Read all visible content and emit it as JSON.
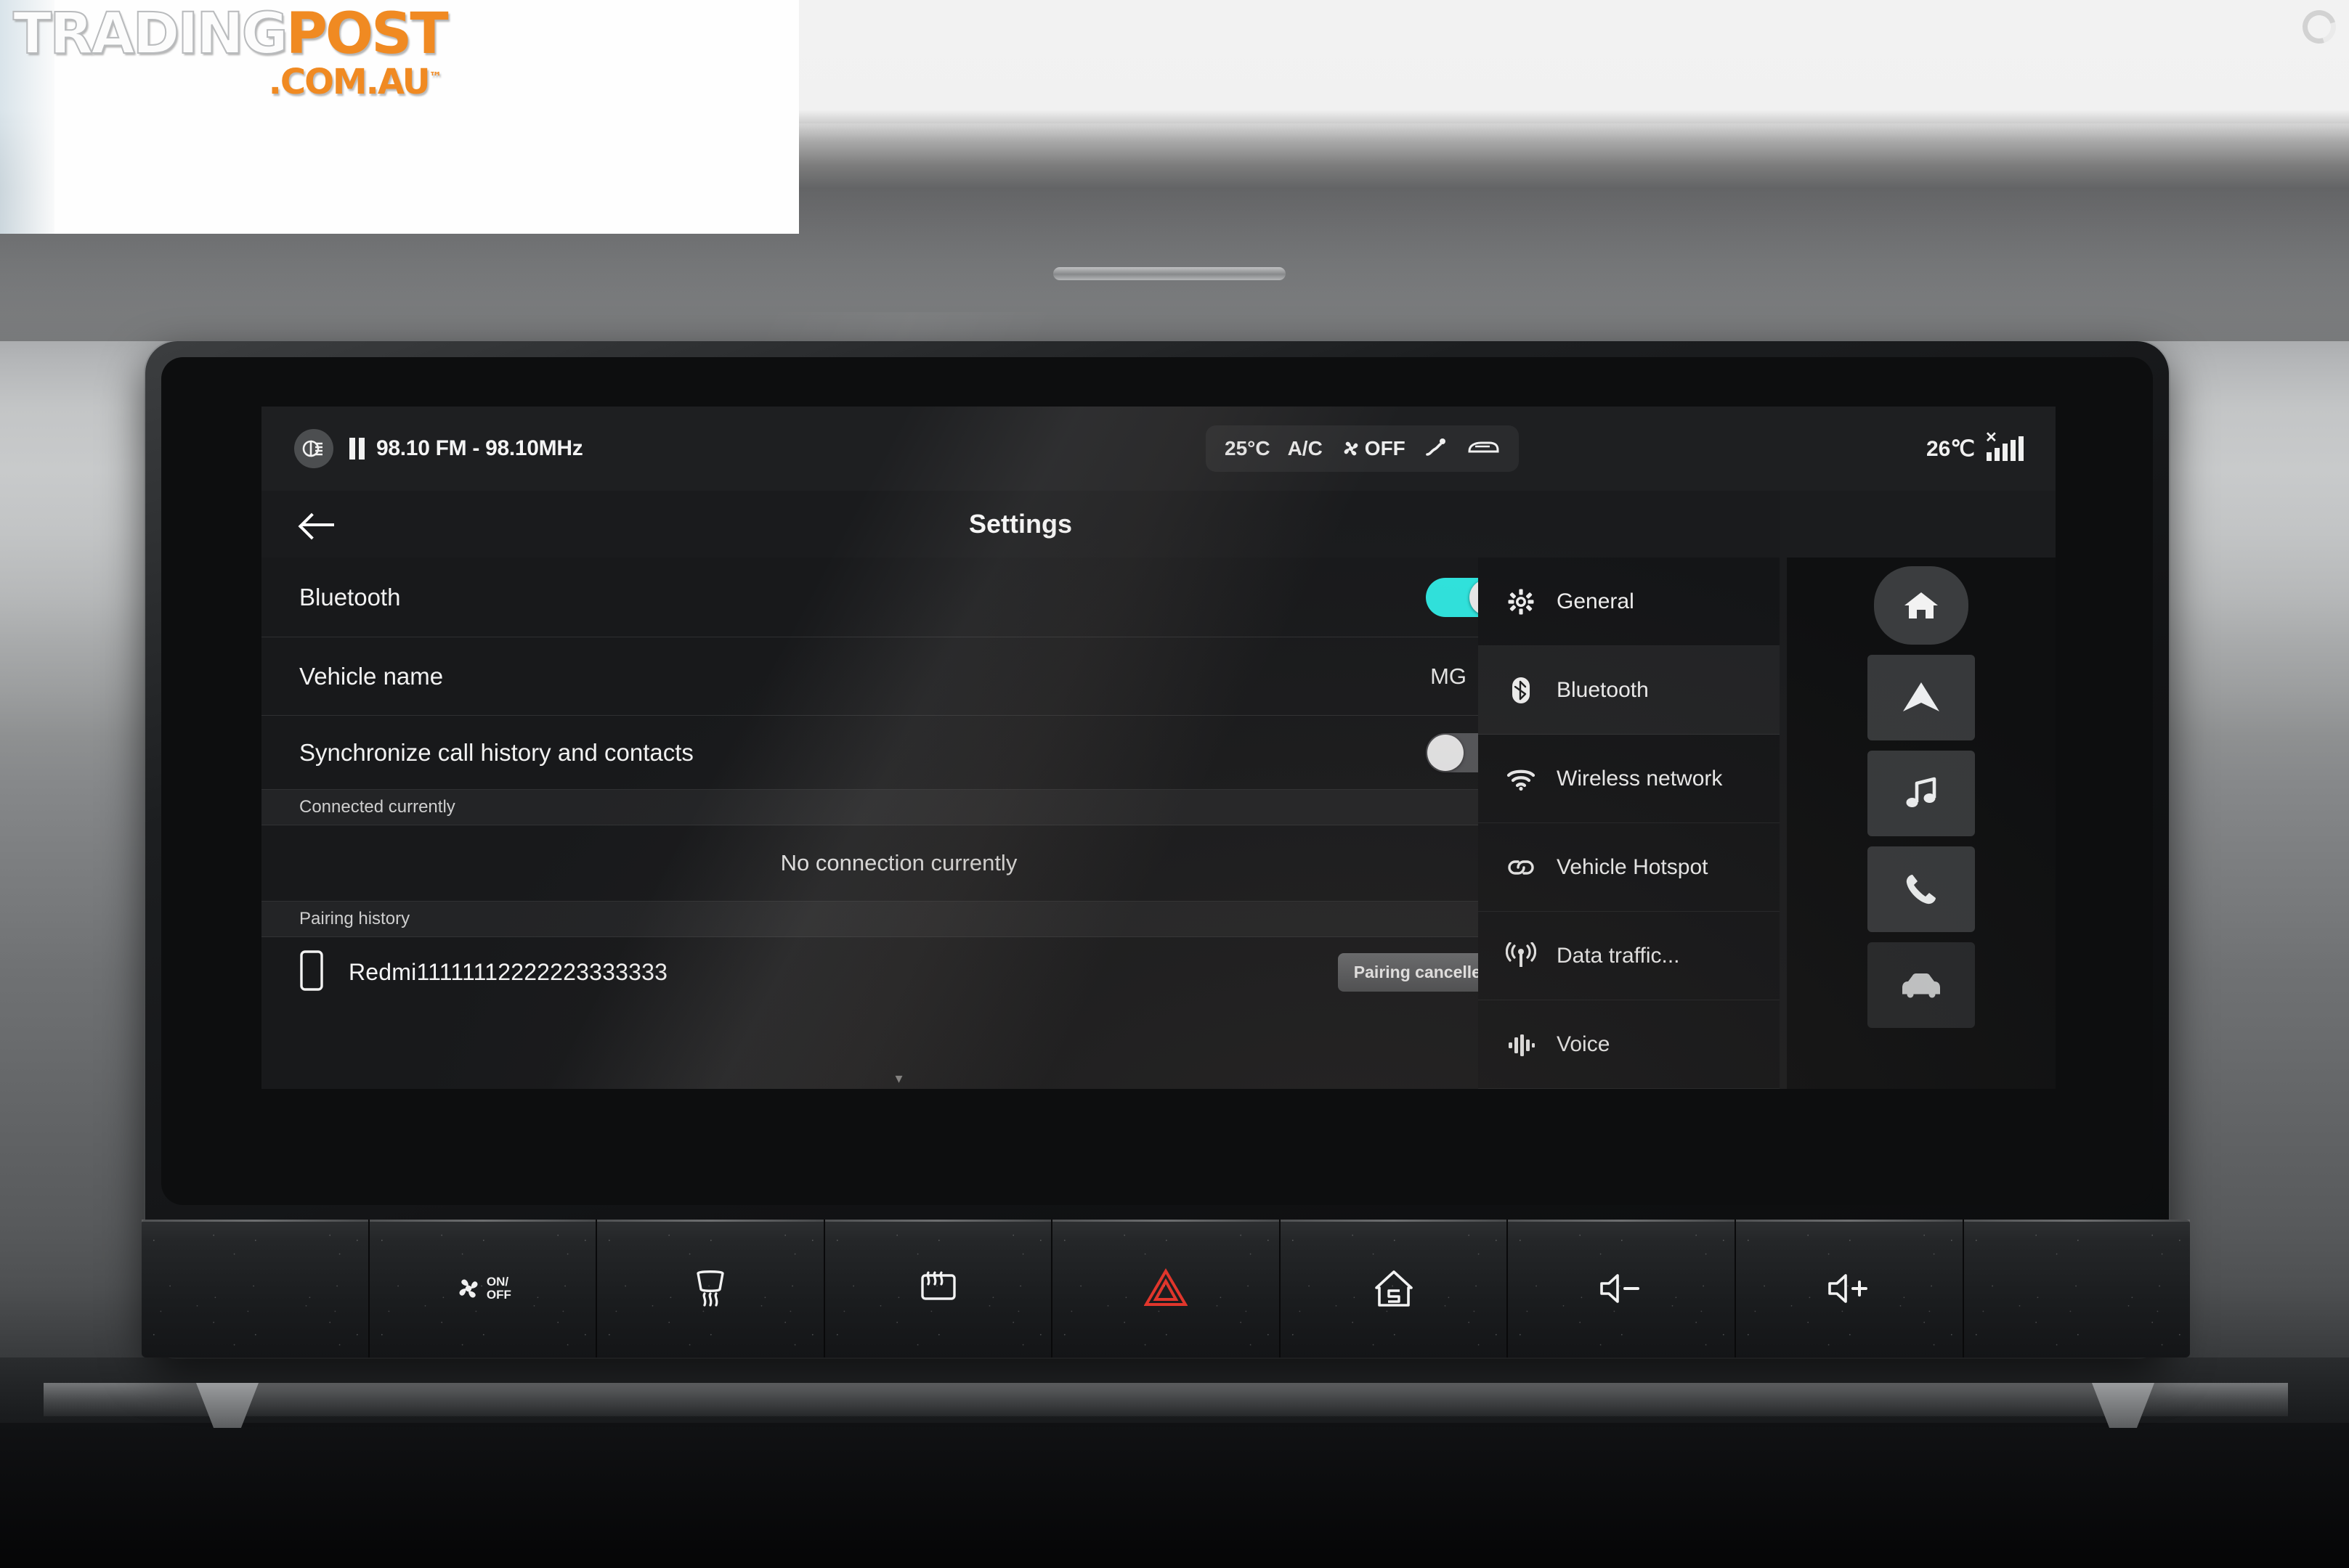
{
  "watermark": {
    "logo_part1": "TRADING",
    "logo_part2": "POST",
    "logo_domain": ".COM.AU",
    "logo_tm": "™",
    "corner_icon": "refresh-icon"
  },
  "status_bar": {
    "source_icon": "radio-source-icon",
    "playback_icon": "pause-icon",
    "media_text": "98.10 FM - 98.10MHz",
    "climate": {
      "temperature": "25°C",
      "ac_label": "A/C",
      "fan_icon": "fan-icon",
      "fan_state": "OFF",
      "airflow_icon": "airflow-feet-icon",
      "defrost_icon": "rear-window-defrost-icon"
    },
    "outside_temperature": "26℃",
    "signal_icon": "signal-bars-icon",
    "signal_bars": 5
  },
  "title_bar": {
    "back_icon": "back-arrow-icon",
    "title": "Settings"
  },
  "settings": {
    "rows": [
      {
        "label": "Bluetooth",
        "control": "toggle",
        "state": "on"
      },
      {
        "label": "Vehicle name",
        "control": "value-chevron",
        "value": "MG"
      },
      {
        "label": "Synchronize call history and contacts",
        "control": "toggle",
        "state": "off"
      }
    ],
    "connected_section_header": "Connected currently",
    "no_connection_text": "No connection currently",
    "pairing_section_header": "Pairing history",
    "paired_devices": [
      {
        "icon": "phone-device-icon",
        "name": "Redmi11111112222223333333",
        "status": "Pairing cancelled"
      }
    ]
  },
  "categories": [
    {
      "label": "General",
      "icon": "gear-icon",
      "active": false
    },
    {
      "label": "Bluetooth",
      "icon": "bluetooth-icon",
      "active": true
    },
    {
      "label": "Wireless network",
      "icon": "wifi-icon",
      "active": false
    },
    {
      "label": "Vehicle Hotspot",
      "icon": "link-icon",
      "active": false
    },
    {
      "label": "Data traffic...",
      "icon": "data-broadcast-icon",
      "active": false
    },
    {
      "label": "Voice",
      "icon": "voice-waveform-icon",
      "active": false
    }
  ],
  "rail": [
    {
      "icon": "home-icon",
      "name": "rail-home"
    },
    {
      "icon": "navigation-icon",
      "name": "rail-navigation"
    },
    {
      "icon": "music-note-icon",
      "name": "rail-media"
    },
    {
      "icon": "phone-icon",
      "name": "rail-phone"
    },
    {
      "icon": "car-icon",
      "name": "rail-vehicle"
    }
  ],
  "hard_buttons": [
    {
      "name": "blank-left",
      "icon": ""
    },
    {
      "name": "fan-on-off",
      "icon": "fan-on-off-icon",
      "line1": "ON/",
      "line2": "OFF"
    },
    {
      "name": "front-defrost",
      "icon": "front-defrost-icon"
    },
    {
      "name": "rear-defrost",
      "icon": "rear-defrost-icon"
    },
    {
      "name": "hazard-lights",
      "icon": "hazard-triangle-icon"
    },
    {
      "name": "home",
      "icon": "home-outline-icon"
    },
    {
      "name": "volume-down",
      "icon": "volume-down-icon"
    },
    {
      "name": "volume-up",
      "icon": "volume-up-icon"
    },
    {
      "name": "blank-right",
      "icon": ""
    }
  ],
  "colors": {
    "toggle_on": "#2fe4de",
    "toggle_off": "#55565a",
    "hazard_red": "#e0362c",
    "brand_orange": "#f08a22",
    "screen_bg": "#18191b"
  }
}
